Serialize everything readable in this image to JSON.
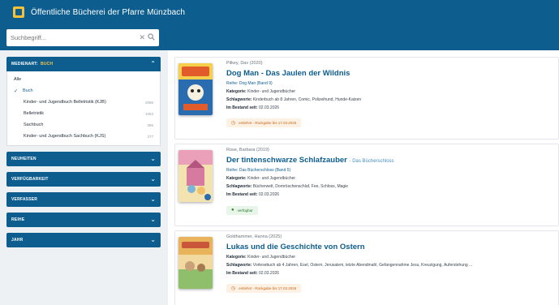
{
  "app": {
    "title": "Öffentliche Bücherei der Pfarre Münzbach"
  },
  "search": {
    "placeholder": "Suchbegriff...",
    "clear_icon": "close-icon",
    "search_icon": "search-icon"
  },
  "sidebar": {
    "facets": [
      {
        "label": "MEDIENART:",
        "selected": "BUCH",
        "open": true
      },
      {
        "label": "NEUHEITEN",
        "open": false
      },
      {
        "label": "VERFÜGBARKEIT",
        "open": false
      },
      {
        "label": "VERFASSER",
        "open": false
      },
      {
        "label": "REIHE",
        "open": false
      },
      {
        "label": "JAHR",
        "open": false
      }
    ],
    "medienart_options": [
      {
        "label": "Alle",
        "count": ""
      },
      {
        "label": "Buch",
        "count": "",
        "selected": true
      },
      {
        "label": "Kinder- und Jugendbuch Belletristik (KJB)",
        "count": "2086"
      },
      {
        "label": "Belletristik",
        "count": "1053"
      },
      {
        "label": "Sachbuch",
        "count": "386"
      },
      {
        "label": "Kinder- und Jugendbuch Sachbuch (KJS)",
        "count": "377"
      }
    ]
  },
  "results": [
    {
      "author": "Pilkey, Dav (2020)",
      "title": "Dog Man - Das Jaulen der Wildnis",
      "title_extra": "",
      "series_label": "Reihe:",
      "series": "Dog Man (Band 9)",
      "category_label": "Kategorie:",
      "category": "Kinder- und Jugendbücher",
      "keywords_label": "Schlagworte:",
      "keywords": "Kinderbuch ab 8 Jahren, Comic, Polizeihund, Hunde-Katzen",
      "since_label": "Im Bestand seit:",
      "since": "02.03.2026",
      "status": "entlehnt - Rückgabe bis 17.03.2026",
      "status_type": "lent",
      "cover_colors": [
        "#e25b2a",
        "#f6d04d",
        "#2a6cb0"
      ]
    },
    {
      "author": "Rose, Barbara (2019)",
      "title": "Der tintenschwarze Schlafzauber",
      "title_extra": "- Das Bücherschloss",
      "series_label": "Reihe:",
      "series": "Das Bücherschloss (Band 5)",
      "category_label": "Kategorie:",
      "category": "Kinder- und Jugendbücher",
      "keywords_label": "Schlagworte:",
      "keywords": "Bücherwelt, Dornröschenschlaf, Fee, Schloss, Magie",
      "since_label": "Im Bestand seit:",
      "since": "02.03.2026",
      "status": "verfügbar",
      "status_type": "avail",
      "cover_colors": [
        "#e9a0b8",
        "#7bb6d8",
        "#f3e3b0"
      ]
    },
    {
      "author": "Goldhammer, Hanna (2025)",
      "title": "Lukas und die Geschichte von Ostern",
      "title_extra": "",
      "series_label": "",
      "series": "",
      "category_label": "Kategorie:",
      "category": "Kinder- und Jugendbücher",
      "keywords_label": "Schlagworte:",
      "keywords": "Vorlesebuch ab 4 Jahren, Esel, Ostern, Jerusalem, letzte Abendmahl, Gefangennahme Jesu, Kreuzigung, Auferstehung ...",
      "since_label": "Im Bestand seit:",
      "since": "02.03.2026",
      "status": "entlehnt - Rückgabe bis 17.03.2026",
      "status_type": "lent",
      "cover_colors": [
        "#e8b35a",
        "#8fbf6a",
        "#c9563a"
      ]
    }
  ]
}
